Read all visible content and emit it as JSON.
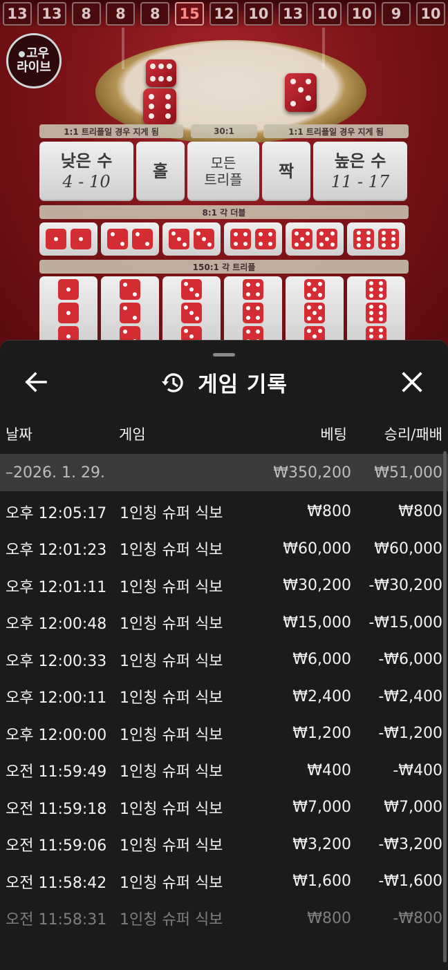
{
  "game": {
    "history_numbers": [
      "13",
      "13",
      "8",
      "8",
      "8",
      "15",
      "12",
      "10",
      "13",
      "10",
      "10",
      "9",
      "10"
    ],
    "highlight_index": 5,
    "logo": {
      "line1": "고우",
      "line2": "라이브"
    },
    "odds": {
      "low_loss": "1:1 트리플일 경우 지게 됨",
      "any_triple": "30:1",
      "high_loss": "1:1 트리플일 경우 지게 됨",
      "double": "8:1 각 더블",
      "triple": "150:1 각 트리플"
    },
    "bets": {
      "small_label": "낮은 수",
      "small_range": "4 - 10",
      "odd_label": "홀",
      "any_triple_line1": "모든",
      "any_triple_line2": "트리플",
      "even_label": "짝",
      "big_label": "높은 수",
      "big_range": "11 - 17"
    }
  },
  "sheet": {
    "title": "게임 기록",
    "icons": {
      "back": "arrow-left-icon",
      "history": "history-icon",
      "close": "close-icon"
    },
    "columns": {
      "date": "날짜",
      "game": "게임",
      "bet": "베팅",
      "win_loss": "승리/패배"
    },
    "date_group": {
      "date": "–2026. 1. 29.",
      "bet_total": "₩350,200",
      "win_loss_total": "₩51,000"
    },
    "rows": [
      {
        "time": "오후 12:05:17",
        "game": "1인칭 슈퍼 식보",
        "bet": "₩800",
        "win_loss": "₩800"
      },
      {
        "time": "오후 12:01:23",
        "game": "1인칭 슈퍼 식보",
        "bet": "₩60,000",
        "win_loss": "₩60,000"
      },
      {
        "time": "오후 12:01:11",
        "game": "1인칭 슈퍼 식보",
        "bet": "₩30,200",
        "win_loss": "-₩30,200"
      },
      {
        "time": "오후 12:00:48",
        "game": "1인칭 슈퍼 식보",
        "bet": "₩15,000",
        "win_loss": "-₩15,000"
      },
      {
        "time": "오후 12:00:33",
        "game": "1인칭 슈퍼 식보",
        "bet": "₩6,000",
        "win_loss": "-₩6,000"
      },
      {
        "time": "오후 12:00:11",
        "game": "1인칭 슈퍼 식보",
        "bet": "₩2,400",
        "win_loss": "-₩2,400"
      },
      {
        "time": "오후 12:00:00",
        "game": "1인칭 슈퍼 식보",
        "bet": "₩1,200",
        "win_loss": "-₩1,200"
      },
      {
        "time": "오전 11:59:49",
        "game": "1인칭 슈퍼 식보",
        "bet": "₩400",
        "win_loss": "-₩400"
      },
      {
        "time": "오전 11:59:18",
        "game": "1인칭 슈퍼 식보",
        "bet": "₩7,000",
        "win_loss": "₩7,000"
      },
      {
        "time": "오전 11:59:06",
        "game": "1인칭 슈퍼 식보",
        "bet": "₩3,200",
        "win_loss": "-₩3,200"
      },
      {
        "time": "오전 11:58:42",
        "game": "1인칭 슈퍼 식보",
        "bet": "₩1,600",
        "win_loss": "-₩1,600"
      },
      {
        "time": "오전 11:58:31",
        "game": "1인칭 슈퍼 식보",
        "bet": "₩800",
        "win_loss": "-₩800"
      }
    ]
  }
}
